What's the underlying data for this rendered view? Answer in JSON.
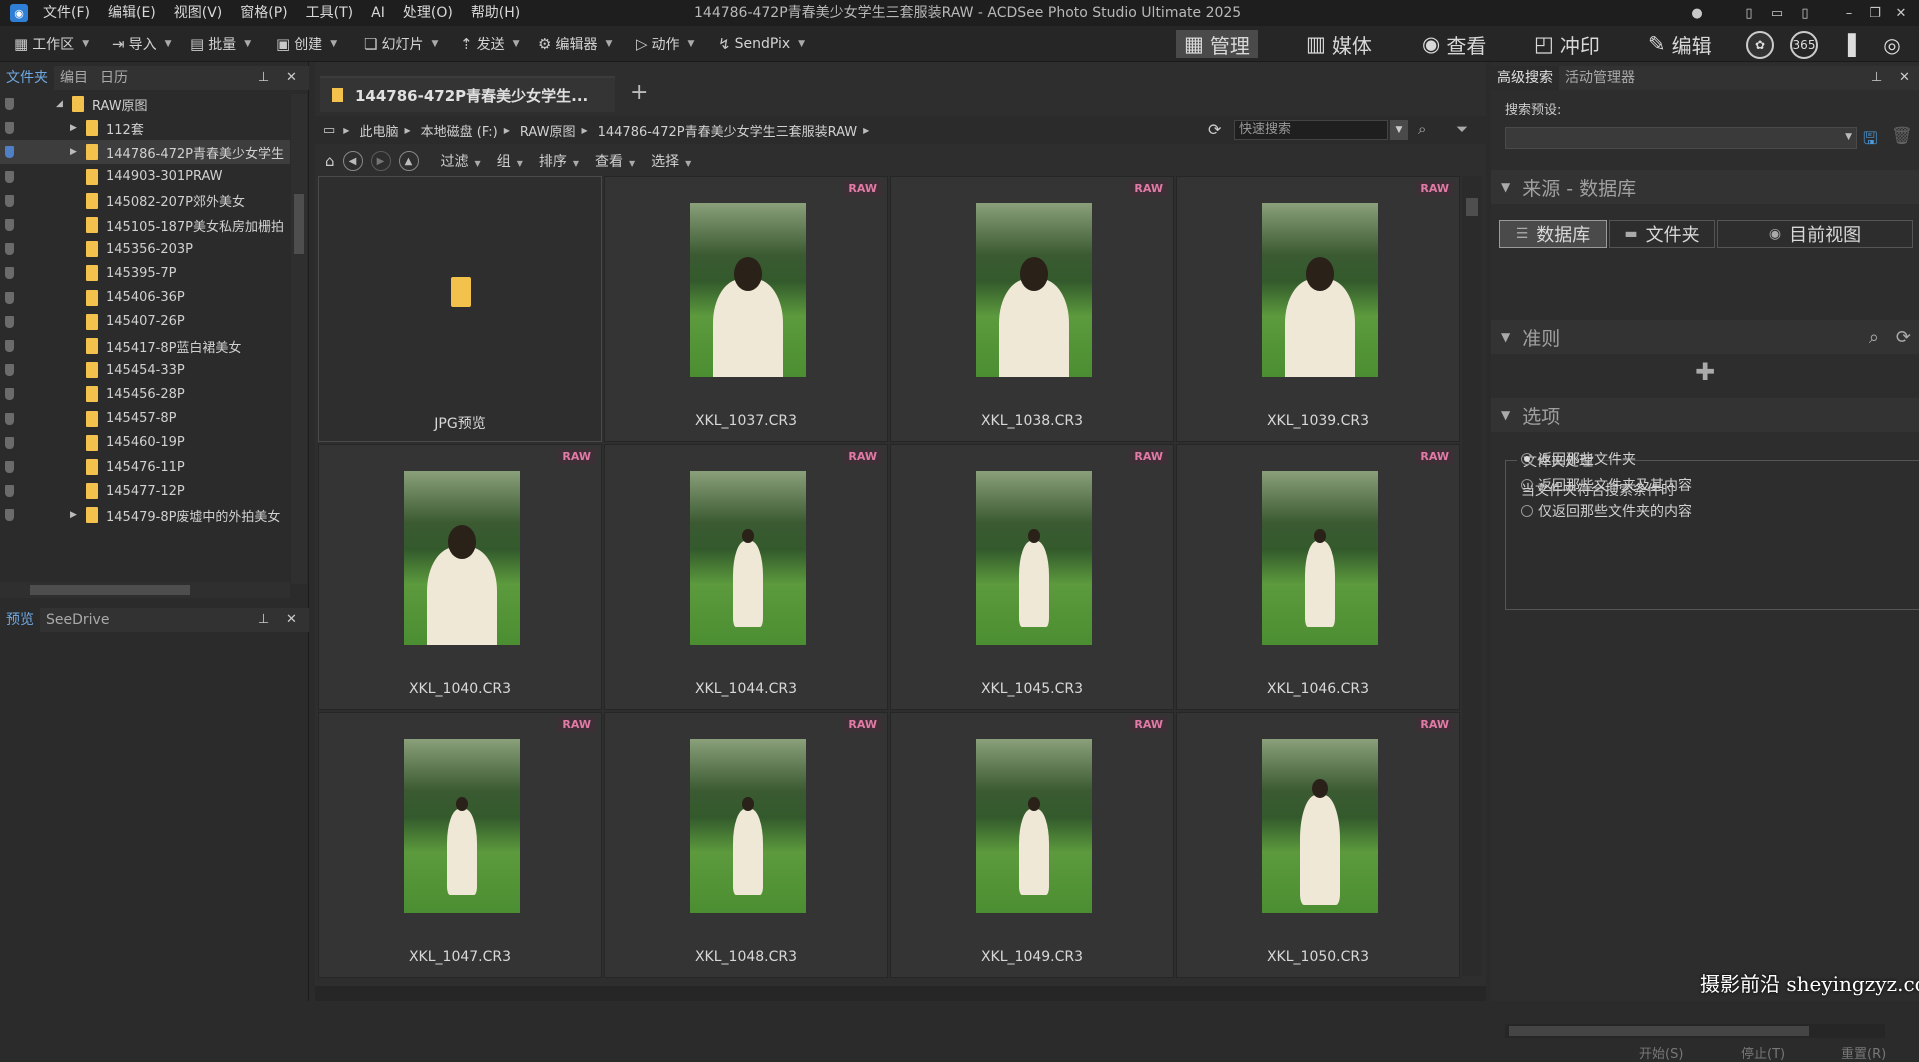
{
  "app": {
    "window_title": "144786-472P青春美少女学生三套服装RAW - ACDSee Photo Studio Ultimate 2025",
    "menu": [
      "文件(F)",
      "编辑(E)",
      "视图(V)",
      "窗格(P)",
      "工具(T)",
      "AI",
      "处理(O)",
      "帮助(H)"
    ]
  },
  "toolbar": {
    "items": [
      {
        "label": "工作区",
        "icon": "grid-icon"
      },
      {
        "label": "导入",
        "icon": "import-icon"
      },
      {
        "label": "批量",
        "icon": "batch-icon"
      },
      {
        "label": "创建",
        "icon": "create-icon"
      },
      {
        "label": "幻灯片",
        "icon": "slideshow-icon"
      },
      {
        "label": "发送",
        "icon": "send-icon"
      },
      {
        "label": "编辑器",
        "icon": "editor-icon"
      },
      {
        "label": "动作",
        "icon": "action-icon"
      },
      {
        "label": "SendPix",
        "icon": "sendpix-icon"
      }
    ],
    "modes": [
      {
        "label": "管理",
        "icon": "manage-icon",
        "active": true
      },
      {
        "label": "媒体",
        "icon": "media-icon"
      },
      {
        "label": "查看",
        "icon": "view-eye-icon"
      },
      {
        "label": "冲印",
        "icon": "develop-icon"
      },
      {
        "label": "编辑",
        "icon": "edit-icon"
      }
    ],
    "extra_icon_text": "365"
  },
  "left_panel": {
    "tabs": [
      "文件夹",
      "编目",
      "日历"
    ],
    "tree": [
      {
        "label": "RAW原图",
        "expanded": true
      },
      {
        "label": "112套"
      },
      {
        "label": "144786-472P青春美少女学生",
        "selected": true
      },
      {
        "label": "144903-301PRAW"
      },
      {
        "label": "145082-207P郊外美女"
      },
      {
        "label": "145105-187P美女私房加栅拍"
      },
      {
        "label": "145356-203P"
      },
      {
        "label": "145395-7P"
      },
      {
        "label": "145406-36P"
      },
      {
        "label": "145407-26P"
      },
      {
        "label": "145417-8P蓝白裙美女"
      },
      {
        "label": "145454-33P"
      },
      {
        "label": "145456-28P"
      },
      {
        "label": "145457-8P"
      },
      {
        "label": "145460-19P"
      },
      {
        "label": "145476-11P"
      },
      {
        "label": "145477-12P"
      },
      {
        "label": "145479-8P废墟中的外拍美女"
      }
    ],
    "preview_tabs": [
      "预览",
      "SeeDrive"
    ]
  },
  "main": {
    "doc_tab": "144786-472P青春美少女学生...",
    "breadcrumb": [
      "此电脑",
      "本地磁盘 (F:)",
      "RAW原图",
      "144786-472P青春美少女学生三套服装RAW"
    ],
    "quick_search_placeholder": "快速搜索",
    "subbar": [
      "过滤",
      "组",
      "排序",
      "查看",
      "选择"
    ],
    "raw_badge": "RAW",
    "items": [
      {
        "name": "JPG预览",
        "type": "folder"
      },
      {
        "name": "XKL_1037.CR3",
        "pose": "close"
      },
      {
        "name": "XKL_1038.CR3",
        "pose": "close"
      },
      {
        "name": "XKL_1039.CR3",
        "pose": "close"
      },
      {
        "name": "XKL_1040.CR3",
        "pose": "close"
      },
      {
        "name": "XKL_1044.CR3",
        "pose": "far"
      },
      {
        "name": "XKL_1045.CR3",
        "pose": "far"
      },
      {
        "name": "XKL_1046.CR3",
        "pose": "far"
      },
      {
        "name": "XKL_1047.CR3",
        "pose": "far"
      },
      {
        "name": "XKL_1048.CR3",
        "pose": "far"
      },
      {
        "name": "XKL_1049.CR3",
        "pose": "far"
      },
      {
        "name": "XKL_1050.CR3",
        "pose": "mid"
      }
    ]
  },
  "right_panel": {
    "tabs": [
      "高级搜索",
      "活动管理器"
    ],
    "preset_label": "搜索预设:",
    "source_section": "来源 - 数据库",
    "source_buttons": [
      "数据库",
      "文件夹",
      "目前视图"
    ],
    "criteria_section": "准则",
    "options_section": "选项",
    "folder_group": "文件夹处理",
    "folder_condition": "当文件夹符合搜索条件时",
    "radios": [
      {
        "label": "返回那些文件夹",
        "checked": true
      },
      {
        "label": "返回那些文件夹及其内容",
        "checked": false
      },
      {
        "label": "仅返回那些文件夹的内容",
        "checked": false
      }
    ],
    "bottom_buttons": [
      "开始(S)",
      "停止(T)",
      "重置(R)"
    ]
  },
  "watermark": "摄影前沿 sheyingzyz.com"
}
